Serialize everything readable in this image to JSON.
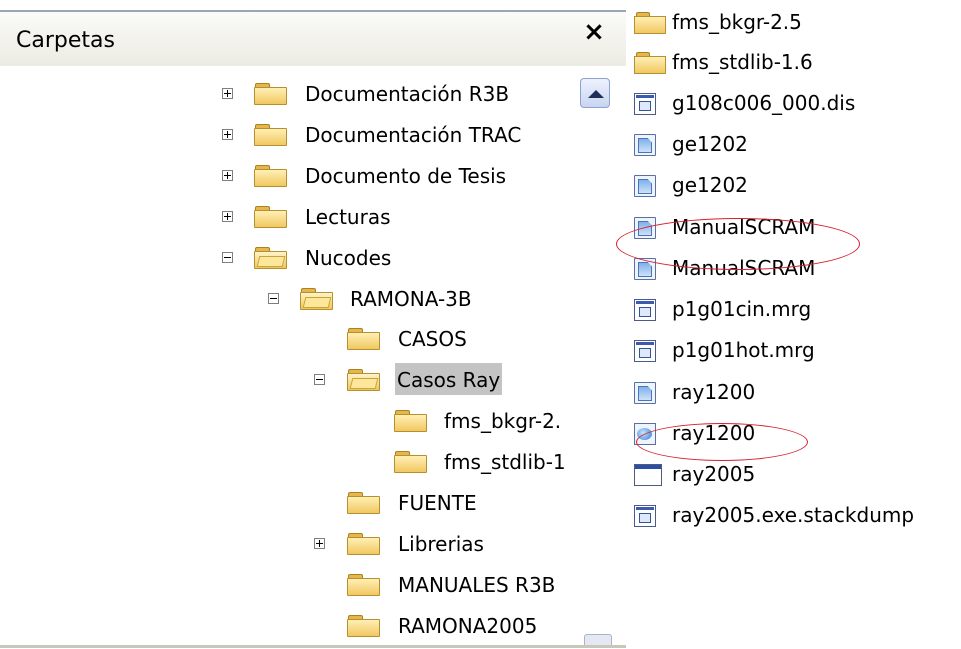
{
  "header": {
    "title": "Carpetas",
    "close_glyph": "×"
  },
  "tree": [
    {
      "label": "Documentación R3B",
      "expander": "plus",
      "icon": "folder-closed-icon"
    },
    {
      "label": "Documentación TRAC",
      "expander": "plus",
      "icon": "folder-closed-icon"
    },
    {
      "label": "Documento de Tesis",
      "expander": "plus",
      "icon": "folder-closed-icon"
    },
    {
      "label": "Lecturas",
      "expander": "plus",
      "icon": "folder-closed-icon"
    },
    {
      "label": "Nucodes",
      "expander": "minus",
      "icon": "folder-open-icon"
    },
    {
      "label": "RAMONA-3B",
      "expander": "minus",
      "icon": "folder-open-icon"
    },
    {
      "label": "CASOS",
      "expander": "none",
      "icon": "folder-closed-icon"
    },
    {
      "label": "Casos Ray",
      "expander": "minus",
      "icon": "folder-open-icon",
      "selected": true
    },
    {
      "label": "fms_bkgr-2.",
      "expander": "none",
      "icon": "folder-closed-icon"
    },
    {
      "label": "fms_stdlib-1",
      "expander": "none",
      "icon": "folder-closed-icon"
    },
    {
      "label": "FUENTE",
      "expander": "none",
      "icon": "folder-closed-icon"
    },
    {
      "label": "Librerias",
      "expander": "plus",
      "icon": "folder-closed-icon"
    },
    {
      "label": "MANUALES R3B",
      "expander": "none",
      "icon": "folder-closed-icon"
    },
    {
      "label": "RAMONA2005",
      "expander": "none",
      "icon": "folder-closed-icon"
    }
  ],
  "files": [
    {
      "label": "fms_bkgr-2.5",
      "icon": "folder-icon"
    },
    {
      "label": "fms_stdlib-1.6",
      "icon": "folder-icon"
    },
    {
      "label": "g108c006_000.dis",
      "icon": "document-icon"
    },
    {
      "label": "ge1202",
      "icon": "executable-icon"
    },
    {
      "label": "ge1202",
      "icon": "executable-icon"
    },
    {
      "label": "ManualSCRAM",
      "icon": "executable-icon"
    },
    {
      "label": "ManualSCRAM",
      "icon": "executable-icon"
    },
    {
      "label": "p1g01cin.mrg",
      "icon": "document-icon"
    },
    {
      "label": "p1g01hot.mrg",
      "icon": "document-icon"
    },
    {
      "label": "ray1200",
      "icon": "executable-icon"
    },
    {
      "label": "ray1200",
      "icon": "executable-shortcut-icon"
    },
    {
      "label": "ray2005",
      "icon": "console-window-icon"
    },
    {
      "label": "ray2005.exe.stackdump",
      "icon": "document-icon"
    }
  ],
  "annotations": {
    "color": "#d6202d"
  },
  "colors": {
    "selection": "#c4c4c4",
    "folder": "#f1c861"
  }
}
